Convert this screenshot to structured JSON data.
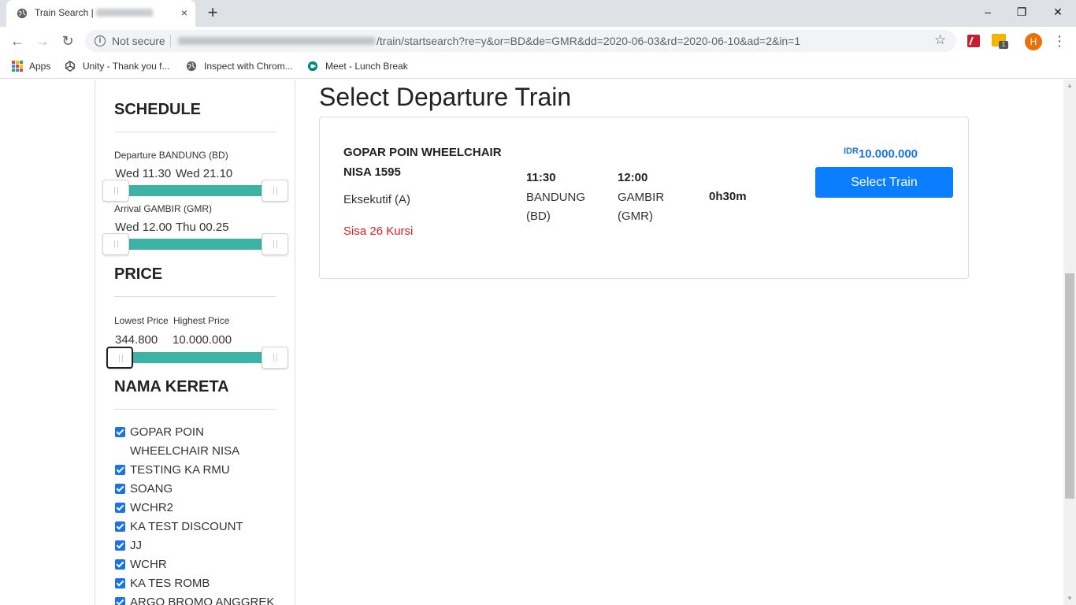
{
  "browser": {
    "tab_title": "Train Search |",
    "new_tab": "+",
    "close_tab": "×",
    "window_controls": {
      "minimize": "–",
      "restore": "❐",
      "close": "✕"
    },
    "security_label": "Not secure",
    "url_path": "/train/startsearch?re=y&or=BD&de=GMR&dd=2020-06-03&rd=2020-06-10&ad=2&in=1",
    "profile_initial": "H",
    "extension_badge": "1",
    "bookmarks": [
      "Apps",
      "Unity - Thank you f...",
      "Inspect with Chrom...",
      "Meet - Lunch Break"
    ],
    "brand_colors": {
      "apps_grid": [
        "#ea4335",
        "#fbbc05",
        "#34a853",
        "#4285f4",
        "#ea4335",
        "#fbbc05",
        "#34a853",
        "#4285f4",
        "#ea4335"
      ]
    }
  },
  "sidebar": {
    "schedule": {
      "title": "SCHEDULE",
      "departure_label": "Departure BANDUNG (BD)",
      "departure_from": "Wed 11.30",
      "departure_to": "Wed 21.10",
      "arrival_label": "Arrival GAMBIR (GMR)",
      "arrival_from": "Wed 12.00",
      "arrival_to": "Thu 00.25"
    },
    "price": {
      "title": "PRICE",
      "lowest_label": "Lowest Price",
      "highest_label": "Highest Price",
      "lowest_value": "344.800",
      "highest_value": "10.000.000"
    },
    "train_names": {
      "title": "NAMA KERETA",
      "items": [
        "GOPAR POIN WHEELCHAIR NISA",
        "TESTING KA RMU",
        "SOANG",
        "WCHR2",
        "KA TEST DISCOUNT",
        "JJ",
        "WCHR",
        "KA TES ROMB",
        "ARGO BROMO ANGGREK"
      ]
    }
  },
  "main": {
    "title": "Select Departure Train",
    "train": {
      "name": "GOPAR POIN WHEELCHAIR NISA 1595",
      "class": "Eksekutif (A)",
      "seats": "Sisa 26 Kursi",
      "depart_time": "11:30",
      "depart_station": "BANDUNG (BD)",
      "arrive_time": "12:00",
      "arrive_station": "GAMBIR (GMR)",
      "duration": "0h30m",
      "currency": "IDR",
      "price": "10.000.000",
      "select_label": "Select Train"
    }
  },
  "colors": {
    "accent": "#0b7dff",
    "slider": "#3db3a5",
    "seats_warning": "#e02020"
  }
}
